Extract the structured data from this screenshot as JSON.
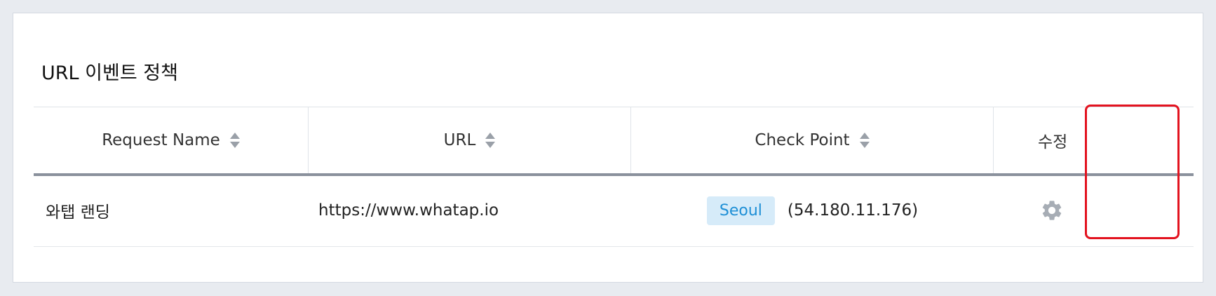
{
  "panel": {
    "title": "URL 이벤트 정책"
  },
  "table": {
    "columns": [
      {
        "label": "Request Name",
        "sortable": true
      },
      {
        "label": "URL",
        "sortable": true
      },
      {
        "label": "Check Point",
        "sortable": true
      },
      {
        "label": "수정",
        "sortable": false
      }
    ],
    "rows": [
      {
        "request_name": "와탭 랜딩",
        "url": "https://www.whatap.io",
        "checkpoint_region": "Seoul",
        "checkpoint_ip": "(54.180.11.176)",
        "edit_icon": "gear-icon"
      }
    ]
  },
  "colors": {
    "badge_bg": "#d6ebf9",
    "badge_text": "#1e8fd6",
    "highlight_border": "#e3131f",
    "header_rule": "#8a919c"
  }
}
